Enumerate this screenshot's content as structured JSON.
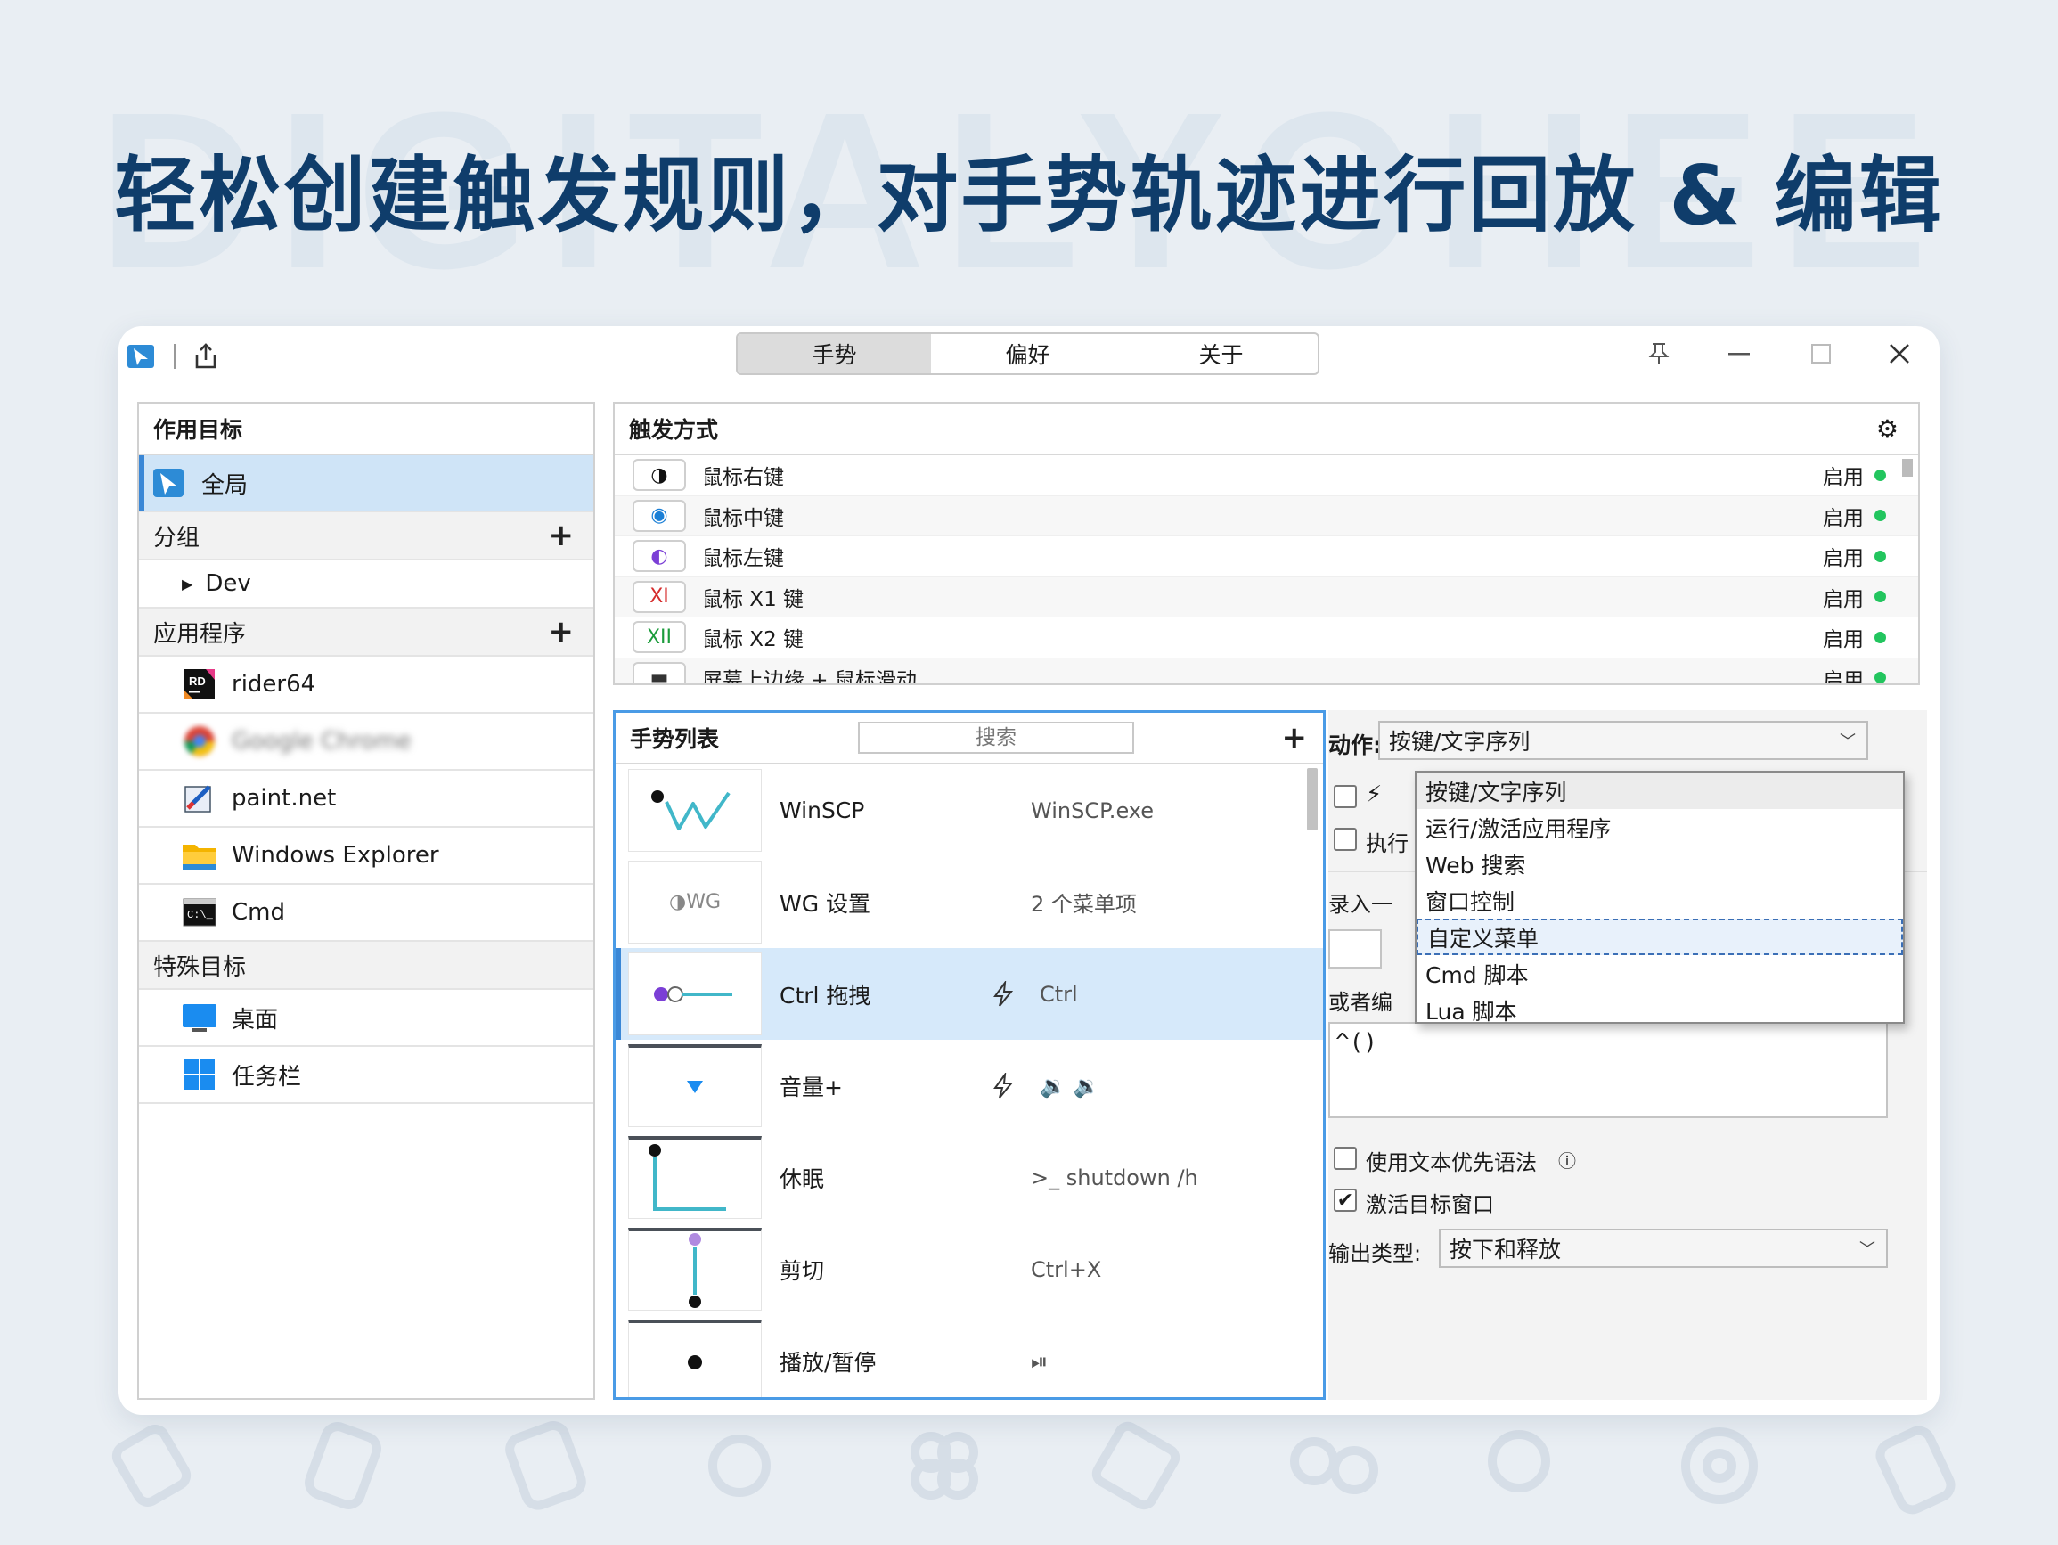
{
  "headline": "轻松创建触发规则，对手势轨迹进行回放 & 编辑",
  "watermark": "DIGITALYOHEE",
  "tabs": [
    "手势",
    "偏好",
    "关于"
  ],
  "left": {
    "header": "作用目标",
    "global": "全局",
    "group": {
      "label": "分组",
      "items": [
        "Dev"
      ]
    },
    "apps": {
      "label": "应用程序",
      "items": [
        "rider64",
        "Google Chrome",
        "paint.net",
        "Windows Explorer",
        "Cmd"
      ]
    },
    "special": {
      "label": "特殊目标",
      "items": [
        "桌面",
        "任务栏"
      ]
    }
  },
  "triggers": {
    "header": "触发方式",
    "items": [
      {
        "icon": "◑",
        "label": "鼠标右键",
        "status": "启用"
      },
      {
        "icon": "◉",
        "label": "鼠标中键",
        "status": "启用"
      },
      {
        "icon": "◐",
        "label": "鼠标左键",
        "status": "启用"
      },
      {
        "icon": "XI",
        "label": "鼠标 X1 键",
        "status": "启用"
      },
      {
        "icon": "XII",
        "label": "鼠标 X2 键",
        "status": "启用"
      },
      {
        "icon": "▬",
        "label": "屏幕上边缘 + 鼠标滑动",
        "status": "启用"
      }
    ]
  },
  "gestures": {
    "header": "手势列表",
    "search_placeholder": "搜索",
    "items": [
      {
        "name": "WinSCP",
        "value": "WinSCP.exe",
        "bolt": false
      },
      {
        "name": "WG 设置",
        "value": "2 个菜单项",
        "bolt": false,
        "thumb": "◑WG"
      },
      {
        "name": "Ctrl 拖拽",
        "value": "Ctrl",
        "bolt": true
      },
      {
        "name": "音量+",
        "value": "🔉 🔉",
        "bolt": true
      },
      {
        "name": "休眠",
        "value": ">_ shutdown /h",
        "bolt": false
      },
      {
        "name": "剪切",
        "value": "Ctrl+X",
        "bolt": false
      },
      {
        "name": "播放/暂停",
        "value": "⏯",
        "bolt": false
      }
    ]
  },
  "action": {
    "label": "动作:",
    "selected": "按键/文字序列",
    "options": [
      "按键/文字序列",
      "运行/激活应用程序",
      "Web 搜索",
      "窗口控制",
      "自定义菜单",
      "Cmd 脚本",
      "Lua 脚本"
    ],
    "exec_label": "执行",
    "record_label": "录入一",
    "or_edit_label": "或者编",
    "script_text": "^()",
    "use_text_priority": "使用文本优先语法",
    "info_icon": "ⓘ",
    "activate_target": "激活目标窗口",
    "output_label": "输出类型:",
    "output_value": "按下和释放"
  }
}
